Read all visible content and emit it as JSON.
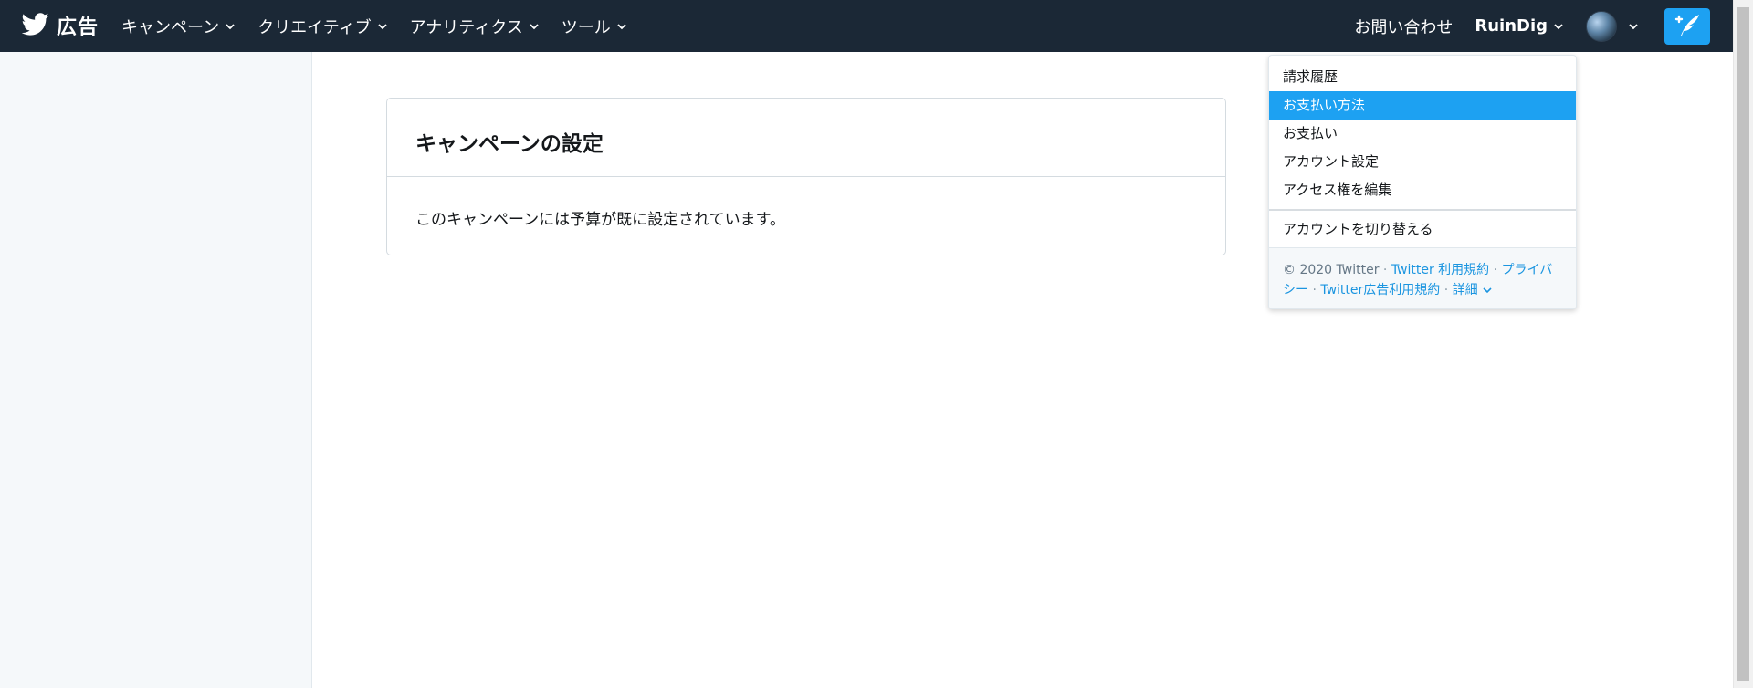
{
  "header": {
    "brand_label": "広告",
    "nav_items": [
      {
        "label": "キャンペーン"
      },
      {
        "label": "クリエイティブ"
      },
      {
        "label": "アナリティクス"
      },
      {
        "label": "ツール"
      }
    ],
    "contact_label": "お問い合わせ",
    "account_name": "RuinDig"
  },
  "main": {
    "card": {
      "title": "キャンペーンの設定",
      "message": "このキャンペーンには予算が既に設定されています。"
    }
  },
  "dropdown": {
    "items": [
      {
        "label": "請求履歴"
      },
      {
        "label": "お支払い方法",
        "active": true
      },
      {
        "label": "お支払い"
      },
      {
        "label": "アカウント設定"
      },
      {
        "label": "アクセス権を編集"
      }
    ],
    "switch_account_label": "アカウントを切り替える",
    "footer": {
      "copyright": "© 2020 Twitter",
      "sep": "·",
      "terms": "Twitter 利用規約",
      "privacy": "プライバシー",
      "ads_terms": "Twitter広告利用規約",
      "more": "詳細"
    }
  },
  "colors": {
    "topbar": "#1b2836",
    "accent": "#1da1f2",
    "link": "#1b95e0",
    "sidebar": "#f5f8fa"
  },
  "icons": {
    "brand": "twitter-bird-icon",
    "nav_dropdown": "chevron-down-icon",
    "compose": "compose-tweet-icon"
  }
}
